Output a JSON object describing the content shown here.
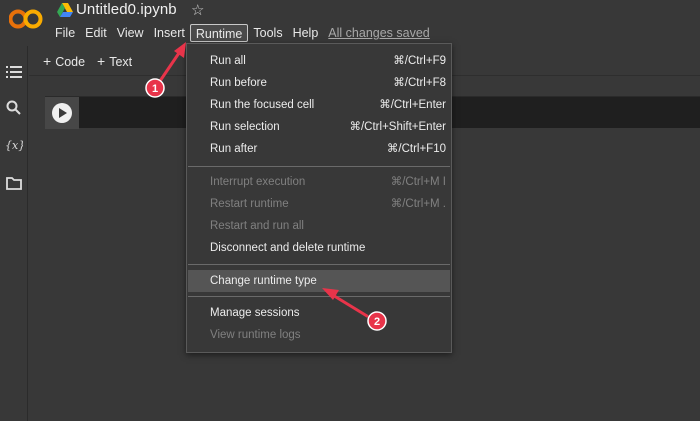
{
  "app": {
    "title": "Untitled0.ipynb",
    "logo_text": "CO"
  },
  "menubar": {
    "items": [
      "File",
      "Edit",
      "View",
      "Insert",
      "Runtime",
      "Tools",
      "Help"
    ],
    "active": "Runtime",
    "saved_status": "All changes saved"
  },
  "toolbar": {
    "code_label": "Code",
    "text_label": "Text"
  },
  "rail_icons": [
    "table-of-contents-icon",
    "search-icon",
    "variables-icon",
    "folder-icon"
  ],
  "runtime_menu": {
    "group1": [
      {
        "label": "Run all",
        "shortcut": "⌘/Ctrl+F9"
      },
      {
        "label": "Run before",
        "shortcut": "⌘/Ctrl+F8"
      },
      {
        "label": "Run the focused cell",
        "shortcut": "⌘/Ctrl+Enter"
      },
      {
        "label": "Run selection",
        "shortcut": "⌘/Ctrl+Shift+Enter"
      },
      {
        "label": "Run after",
        "shortcut": "⌘/Ctrl+F10"
      }
    ],
    "group2": [
      {
        "label": "Interrupt execution",
        "shortcut": "⌘/Ctrl+M I"
      },
      {
        "label": "Restart runtime",
        "shortcut": "⌘/Ctrl+M ."
      },
      {
        "label": "Restart and run all",
        "shortcut": ""
      },
      {
        "label": "Disconnect and delete runtime",
        "shortcut": ""
      }
    ],
    "group3": [
      {
        "label": "Change runtime type",
        "shortcut": ""
      }
    ],
    "group4": [
      {
        "label": "Manage sessions",
        "shortcut": ""
      },
      {
        "label": "View runtime logs",
        "shortcut": ""
      }
    ]
  },
  "annotations": {
    "marker1": "1",
    "marker2": "2",
    "color": "#e8344a"
  },
  "colors": {
    "background": "#383838",
    "logo_orange": "#f9ab00",
    "logo_dark_orange": "#e8710a",
    "cell_bg": "#1f1f1f",
    "disabled_text": "#808080"
  }
}
